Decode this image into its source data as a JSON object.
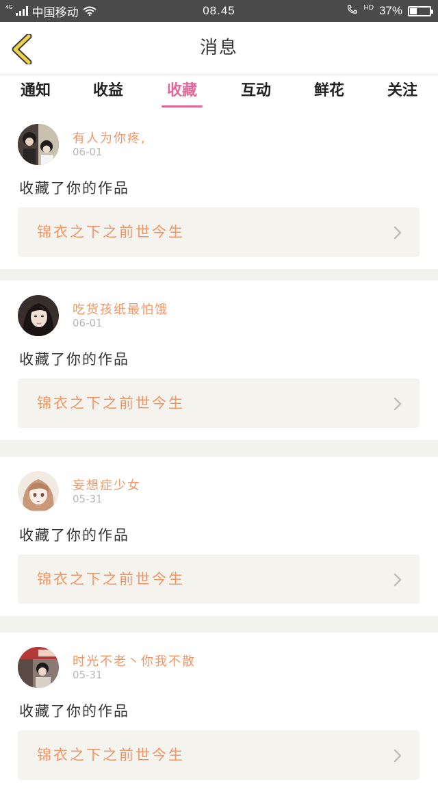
{
  "status_bar": {
    "network_label": "4G",
    "carrier": "中国移动",
    "time": "08.45",
    "hd_label": "HD",
    "battery_percent": "37%",
    "battery_level": 0.37
  },
  "header": {
    "title": "消息"
  },
  "tabs": [
    {
      "label": "通知",
      "active": false
    },
    {
      "label": "收益",
      "active": false
    },
    {
      "label": "收藏",
      "active": true
    },
    {
      "label": "互动",
      "active": false
    },
    {
      "label": "鲜花",
      "active": false
    },
    {
      "label": "关注",
      "active": false
    }
  ],
  "messages": [
    {
      "username": "有人为你疼,",
      "date": "06-01",
      "action": "收藏了你的作品",
      "work_title": "锦衣之下之前世今生"
    },
    {
      "username": "吃货孩纸最怕饿",
      "date": "06-01",
      "action": "收藏了你的作品",
      "work_title": "锦衣之下之前世今生"
    },
    {
      "username": "妄想症少女",
      "date": "05-31",
      "action": "收藏了你的作品",
      "work_title": "锦衣之下之前世今生"
    },
    {
      "username": "时光不老丶你我不散",
      "date": "05-31",
      "action": "收藏了你的作品",
      "work_title": "锦衣之下之前世今生"
    }
  ],
  "colors": {
    "accent": "#e0679a",
    "username": "#f09666",
    "back_arrow": "#f0d34a"
  }
}
